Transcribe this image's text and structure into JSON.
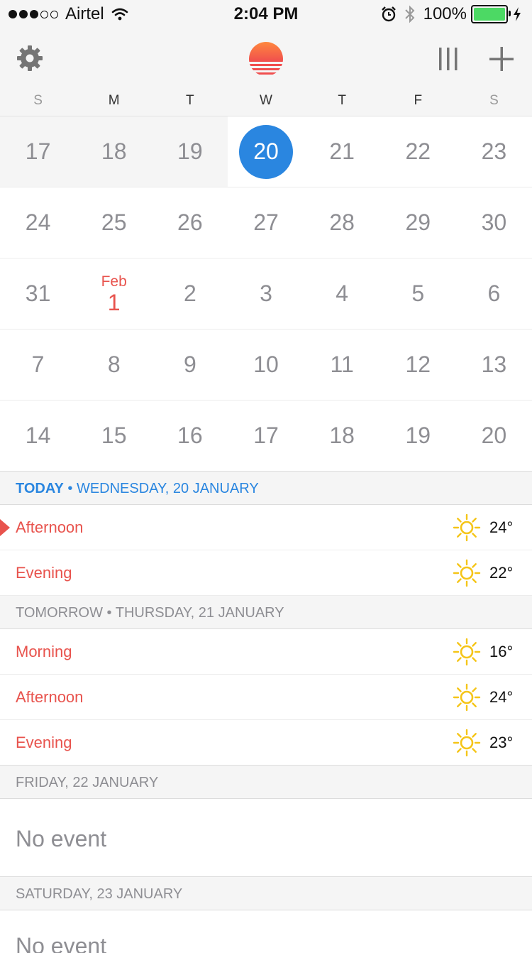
{
  "status_bar": {
    "carrier": "Airtel",
    "time": "2:04 PM",
    "battery": "100%",
    "signal_bars": 3,
    "signal_total": 5,
    "battery_level": 1.0
  },
  "toolbar": {
    "settings_icon": "gear-icon",
    "logo_icon": "sunrise-logo-icon",
    "view_icon": "columns-view-icon",
    "add_icon": "plus-icon",
    "logo_colors": [
      "#ff8a3d",
      "#f04e4e"
    ]
  },
  "weekdays": [
    "S",
    "M",
    "T",
    "W",
    "T",
    "F",
    "S"
  ],
  "calendar": {
    "today": "20",
    "month_start_label": "Feb",
    "weeks": [
      [
        "17",
        "18",
        "19",
        "20",
        "21",
        "22",
        "23"
      ],
      [
        "24",
        "25",
        "26",
        "27",
        "28",
        "29",
        "30"
      ],
      [
        "31",
        "1",
        "2",
        "3",
        "4",
        "5",
        "6"
      ],
      [
        "7",
        "8",
        "9",
        "10",
        "11",
        "12",
        "13"
      ],
      [
        "14",
        "15",
        "16",
        "17",
        "18",
        "19",
        "20"
      ]
    ],
    "accent_color": "#2a86e0",
    "highlight_color": "#e8534d"
  },
  "agenda": {
    "today": {
      "title": "TODAY",
      "date": "WEDNESDAY, 20 JANUARY",
      "rows": [
        {
          "label": "Afternoon",
          "temp": "24°",
          "icon": "sun-icon"
        },
        {
          "label": "Evening",
          "temp": "22°",
          "icon": "sun-icon"
        }
      ]
    },
    "tomorrow": {
      "title": "TOMORROW",
      "date": "THURSDAY, 21 JANUARY",
      "rows": [
        {
          "label": "Morning",
          "temp": "16°",
          "icon": "sun-icon"
        },
        {
          "label": "Afternoon",
          "temp": "24°",
          "icon": "sun-icon"
        },
        {
          "label": "Evening",
          "temp": "23°",
          "icon": "sun-icon"
        }
      ]
    },
    "friday": {
      "date": "FRIDAY, 22 JANUARY",
      "empty": "No event"
    },
    "saturday": {
      "date": "SATURDAY, 23 JANUARY",
      "empty": "No event"
    },
    "separator": "•",
    "sun_color": "#f5c518"
  }
}
